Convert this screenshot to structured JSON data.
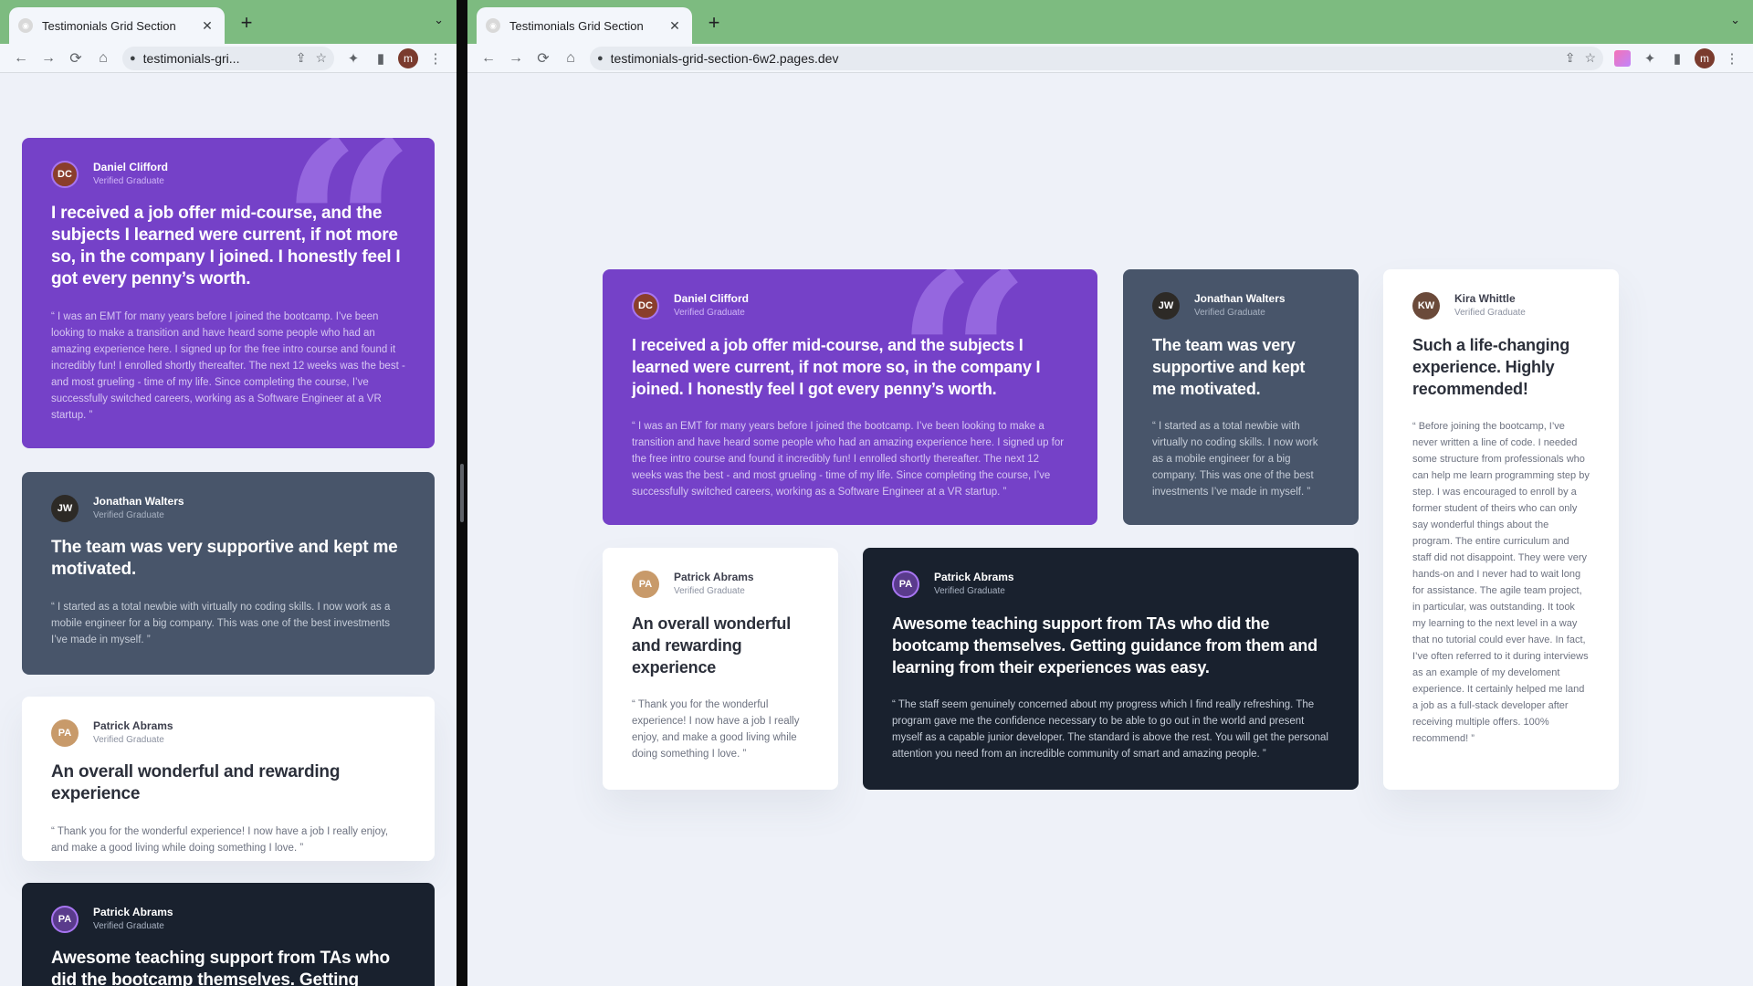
{
  "left_window": {
    "tab": {
      "title": "Testimonials Grid Section"
    },
    "toolbar": {
      "url": "testimonials-gri..."
    },
    "profile_initial": "m"
  },
  "right_window": {
    "tab": {
      "title": "Testimonials Grid Section"
    },
    "toolbar": {
      "url": "testimonials-grid-section-6w2.pages.dev"
    },
    "profile_initial": "m"
  },
  "icons": {
    "back": "←",
    "forward": "→",
    "reload": "⟳",
    "home": "⌂",
    "lock": "🔒",
    "share": "⇪",
    "star": "☆",
    "extensions": "✦",
    "sidepanel": "▮",
    "menu": "⋮",
    "new_tab": "+",
    "close": "✕",
    "dropdown": "⌄",
    "quote": "“"
  },
  "colors": {
    "purple": "#7541c8",
    "slate": "#48556a",
    "dark": "#19212e",
    "white": "#ffffff",
    "page_bg": "#eef1f8",
    "chrome_tabstrip": "#7dbb80"
  },
  "testimonials": [
    {
      "name": "Daniel Clifford",
      "status": "Verified Graduate",
      "summary": "I received a job offer mid-course, and the subjects I learned were current, if not more so, in the company I joined. I honestly feel I got every penny’s worth.",
      "text": "“ I was an EMT for many years before I joined the bootcamp. I’ve been looking to make a transition and have heard some people who had an amazing experience here. I signed up for the free intro course and found it incredibly fun! I enrolled shortly thereafter. The next 12 weeks was the best - and most grueling - time of my life. Since completing the course, I’ve successfully switched careers, working as a Software Engineer at a VR startup. ”",
      "avatar_initials": "DC"
    },
    {
      "name": "Jonathan Walters",
      "status": "Verified Graduate",
      "summary": "The team was very supportive and kept me motivated.",
      "text": "“ I started as a total newbie with virtually no coding skills. I now work as a mobile engineer for a big company. This was one of the best investments I’ve made in myself. ”",
      "avatar_initials": "JW"
    },
    {
      "name": "Kira Whittle",
      "status": "Verified Graduate",
      "summary": "Such a life-changing experience. Highly recommended!",
      "text": "“ Before joining the bootcamp, I’ve never written a line of code. I needed some structure from professionals who can help me learn programming step by step. I was encouraged to enroll by a former student of theirs who can only say wonderful things about the program. The entire curriculum and staff did not disappoint. They were very hands-on and I never had to wait long for assistance. The agile team project, in particular, was outstanding. It took my learning to the next level in a way that no tutorial could ever have. In fact, I’ve often referred to it during interviews as an example of my develoment experience. It certainly helped me land a job as a full-stack developer after receiving multiple offers. 100% recommend! ”",
      "avatar_initials": "KW"
    },
    {
      "name": "Patrick Abrams",
      "status": "Verified Graduate",
      "summary": "An overall wonderful and rewarding experience",
      "text": "“ Thank you for the wonderful experience! I now have a job I really enjoy, and make a good living while doing something I love. ”",
      "avatar_initials": "PA"
    },
    {
      "name": "Patrick Abrams",
      "status": "Verified Graduate",
      "summary": "Awesome teaching support from TAs who did the bootcamp themselves. Getting guidance from them and learning from their experiences was easy.",
      "text": "“ The staff seem genuinely concerned about my progress which I find really refreshing. The program gave me the confidence necessary to be able to go out in the world and present myself as a capable junior developer. The standard is above the rest. You will get the personal attention you need from an incredible community of smart and amazing people. ”",
      "avatar_initials": "PA"
    }
  ],
  "left_truncated_summary": "Awesome teaching support from TAs who did the bootcamp themselves. Getting guidance"
}
